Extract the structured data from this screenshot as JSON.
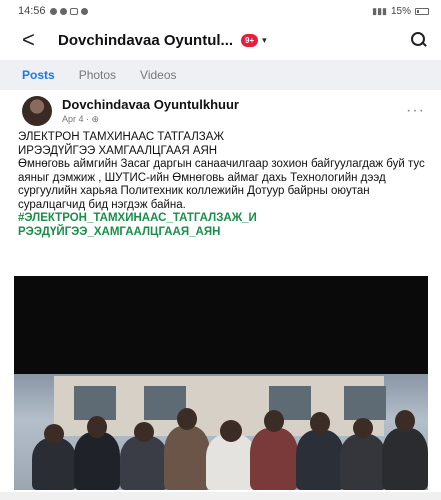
{
  "status_bar": {
    "time": "14:56",
    "battery": "15%"
  },
  "nav": {
    "back_glyph": "<",
    "title": "Dovchindavaa Oyuntul...",
    "badge": "9+",
    "caret_glyph": "▾"
  },
  "tabs": [
    {
      "label": "Posts",
      "active": true
    },
    {
      "label": "Photos",
      "active": false
    },
    {
      "label": "Videos",
      "active": false
    }
  ],
  "post": {
    "author": "Dovchindavaa Oyuntulkhuur",
    "date": "Apr 4 · ",
    "headline": "ЭЛЕКТРОН ТАМХИНААС ТАТГАЛЗАЖ\nИРЭЭДҮЙГЭЭ ХАМГААЛЦГААЯ АЯН",
    "body": "Өмнөговь аймгийн Засаг даргын санаачилгаар зохион байгуулагдаж буй тус аяныг дэмжиж , ШУТИС-ийн Өмнөговь аймаг дахь Технологийн дээд сургуулийн харьяа Политехник коллежийн Дотуур байрны оюутан суралцагчид бид нэгдэж байна.",
    "hashtag": "#ЭЛЕКТРОН_ТАМХИНААС_ТАТГАЛЗАЖ_И\nРЭЭДҮЙГЭЭ_ХАМГААЛЦГААЯ_АЯН"
  },
  "icons": [
    "back-icon",
    "search-icon",
    "globe-icon",
    "more-icon"
  ]
}
